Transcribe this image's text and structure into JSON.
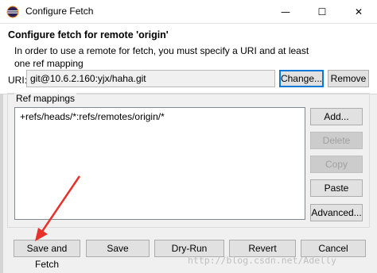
{
  "window": {
    "title": "Configure Fetch",
    "minimize_glyph": "—",
    "maximize_glyph": "☐",
    "close_glyph": "✕"
  },
  "header": {
    "title": "Configure fetch for remote 'origin'",
    "description": "In order to use a remote for fetch, you must specify a URI and at least one ref mapping"
  },
  "uri": {
    "label": "URI:",
    "value": "git@10.6.2.160:yjx/haha.git",
    "change_button": "Change...",
    "remove_button": "Remove"
  },
  "ref_mappings": {
    "group_label": "Ref mappings",
    "items": [
      "+refs/heads/*:refs/remotes/origin/*"
    ],
    "buttons": {
      "add": "Add...",
      "delete": "Delete",
      "copy": "Copy",
      "paste": "Paste",
      "advanced": "Advanced..."
    }
  },
  "footer": {
    "save_and_fetch": "Save and Fetch",
    "save": "Save",
    "dry_run": "Dry-Run",
    "revert": "Revert",
    "cancel": "Cancel"
  },
  "watermark": "http://blog.csdn.net/Adelly",
  "colors": {
    "arrow": "#e8312b",
    "focus": "#0078d7"
  },
  "icons": {
    "app": "eclipse-icon"
  }
}
